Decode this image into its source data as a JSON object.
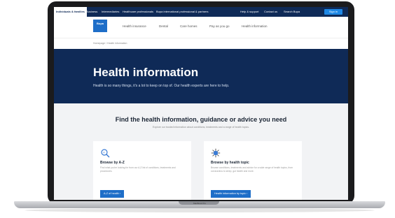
{
  "topbar": {
    "tabs": [
      "Individuals & families",
      "Business",
      "Intermediaries",
      "Healthcare professionals",
      "Bupa international professional & partners"
    ],
    "utility": [
      "Help & support",
      "Contact us",
      "Search Bupa"
    ],
    "sign_in": "Sign in"
  },
  "nav": {
    "logo": "Bupa",
    "items": [
      "Health insurance",
      "Dental",
      "Care homes",
      "Pay as you go",
      "Health information"
    ]
  },
  "breadcrumb": "Homepage  /  Health information",
  "hero": {
    "title": "Health information",
    "subtitle": "Health is so many things, it's a lot to keep on top of. Our health experts are here to help."
  },
  "find": {
    "title": "Find the health information, guidance or advice you need",
    "subtitle": "Explore our trusted information about conditions, treatments and a range of health topics."
  },
  "cards": [
    {
      "icon": "magnifier-icon",
      "title": "Browse by A-Z",
      "desc": "Find what you're looking for from our A-Z list of conditions, treatments and procedures.",
      "button": "A-Z of health  ›"
    },
    {
      "icon": "virus-icon",
      "title": "Browse by health topic",
      "desc": "Browse conditions, treatments and advice for a wide range of health topics, from coronavirus to sleep, gut health and more.",
      "button": "Health information by topic  ›"
    }
  ],
  "device": {
    "model": "MacBook Pro"
  }
}
